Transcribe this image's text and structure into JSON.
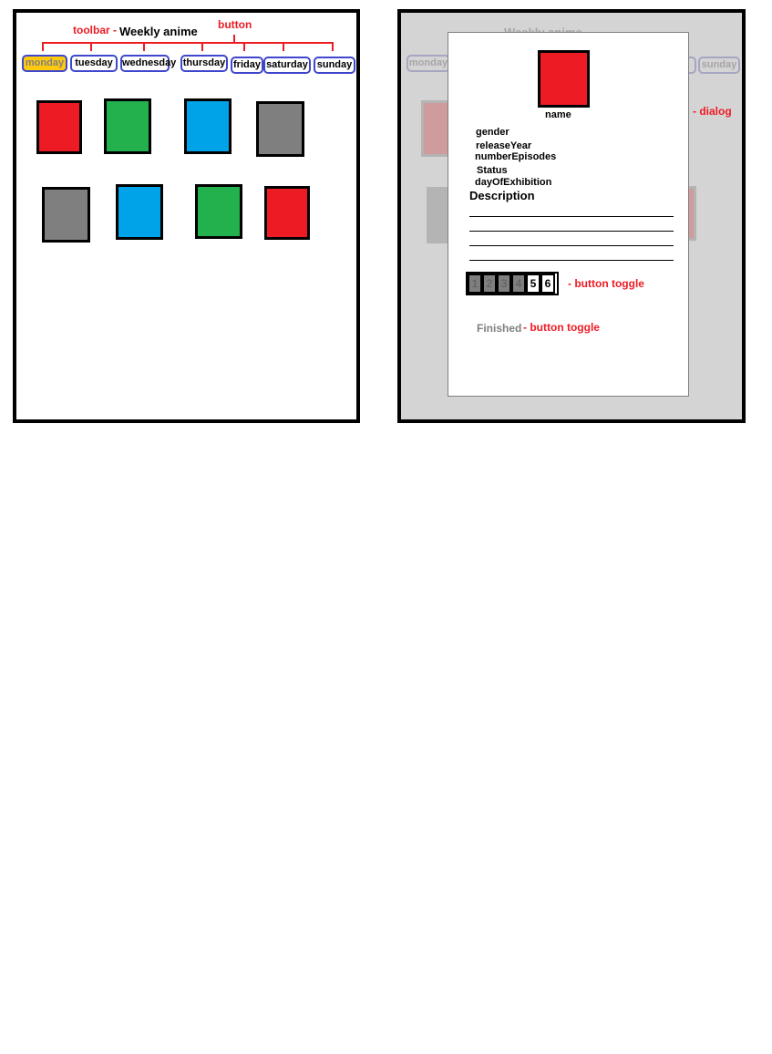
{
  "left_panel": {
    "title": "Weekly anime",
    "notes": {
      "toolbar": "toolbar -",
      "button": "button"
    },
    "days": [
      "monday",
      "tuesday",
      "wednesday",
      "thursday",
      "friday",
      "saturday",
      "sunday"
    ],
    "active_day": "monday",
    "tiles_row1": [
      "#ed1c24",
      "#22b14c",
      "#00a2e8",
      "#7f7f7f"
    ],
    "tiles_row2": [
      "#7f7f7f",
      "#00a2e8",
      "#22b14c",
      "#ed1c24"
    ]
  },
  "right_panel": {
    "background_title": "Weekly anime",
    "background_days": [
      "monday",
      "sunday"
    ],
    "dialog_note": "- dialog",
    "dialog": {
      "cover_color": "#ed1c24",
      "name": "name",
      "fields": [
        "gender",
        "releaseYear",
        "numberEpisodes",
        "Status",
        "dayOfExhibition"
      ],
      "description_label": "Description",
      "episodes": [
        "1",
        "2",
        "3",
        "4",
        "5",
        "6"
      ],
      "episodes_toggle_note": "- button toggle",
      "finished_label": "Finished",
      "finished_toggle_note": "- button toggle"
    }
  },
  "colors": {
    "accent_red": "#ed1c24",
    "button_border": "#3f48cc",
    "active_yellow": "#ffc90e"
  }
}
